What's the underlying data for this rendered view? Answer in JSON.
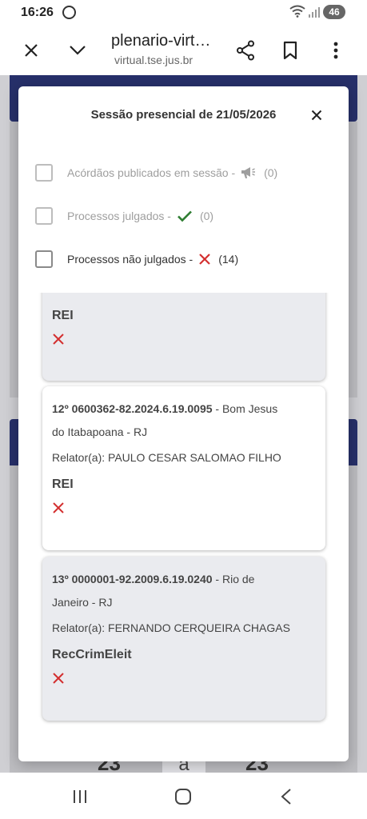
{
  "status_bar": {
    "time": "16:26",
    "battery": "46"
  },
  "browser": {
    "title": "plenario-virt…",
    "url": "virtual.tse.jus.br"
  },
  "modal": {
    "title": "Sessão presencial de 21/05/2026",
    "filters": [
      {
        "label": "Acórdãos publicados em sessão -",
        "icon": "megaphone-icon",
        "count": "(0)",
        "enabled": false
      },
      {
        "label": "Processos julgados -",
        "icon": "checkmark-icon",
        "count": "(0)",
        "enabled": false
      },
      {
        "label": "Processos não julgados -",
        "icon": "cross-icon",
        "count": "(14)",
        "enabled": true
      }
    ]
  },
  "cases": [
    {
      "classe": "REI",
      "status_icon": "cross-icon"
    },
    {
      "number": "12º 0600362-82.2024.6.19.0095",
      "location_line1": " - Bom Jesus",
      "location_line2": "do Itabapoana - RJ",
      "relator": "Relator(a): PAULO CESAR SALOMAO FILHO",
      "classe": "REI",
      "status_icon": "cross-icon"
    },
    {
      "number": "13º 0000001-92.2009.6.19.0240",
      "location_line1": " - Rio de",
      "location_line2": "Janeiro - RJ",
      "relator": "Relator(a): FERNANDO CERQUEIRA CHAGAS",
      "classe": "RecCrimEleit",
      "status_icon": "cross-icon"
    }
  ],
  "background": {
    "digit_left": "23",
    "digit_mid": "a",
    "digit_right": "23"
  },
  "colors": {
    "header_navy": "#27306a",
    "check_green": "#2e7d32",
    "cross_red": "#d32f2f",
    "card_grey": "#eaebef"
  }
}
